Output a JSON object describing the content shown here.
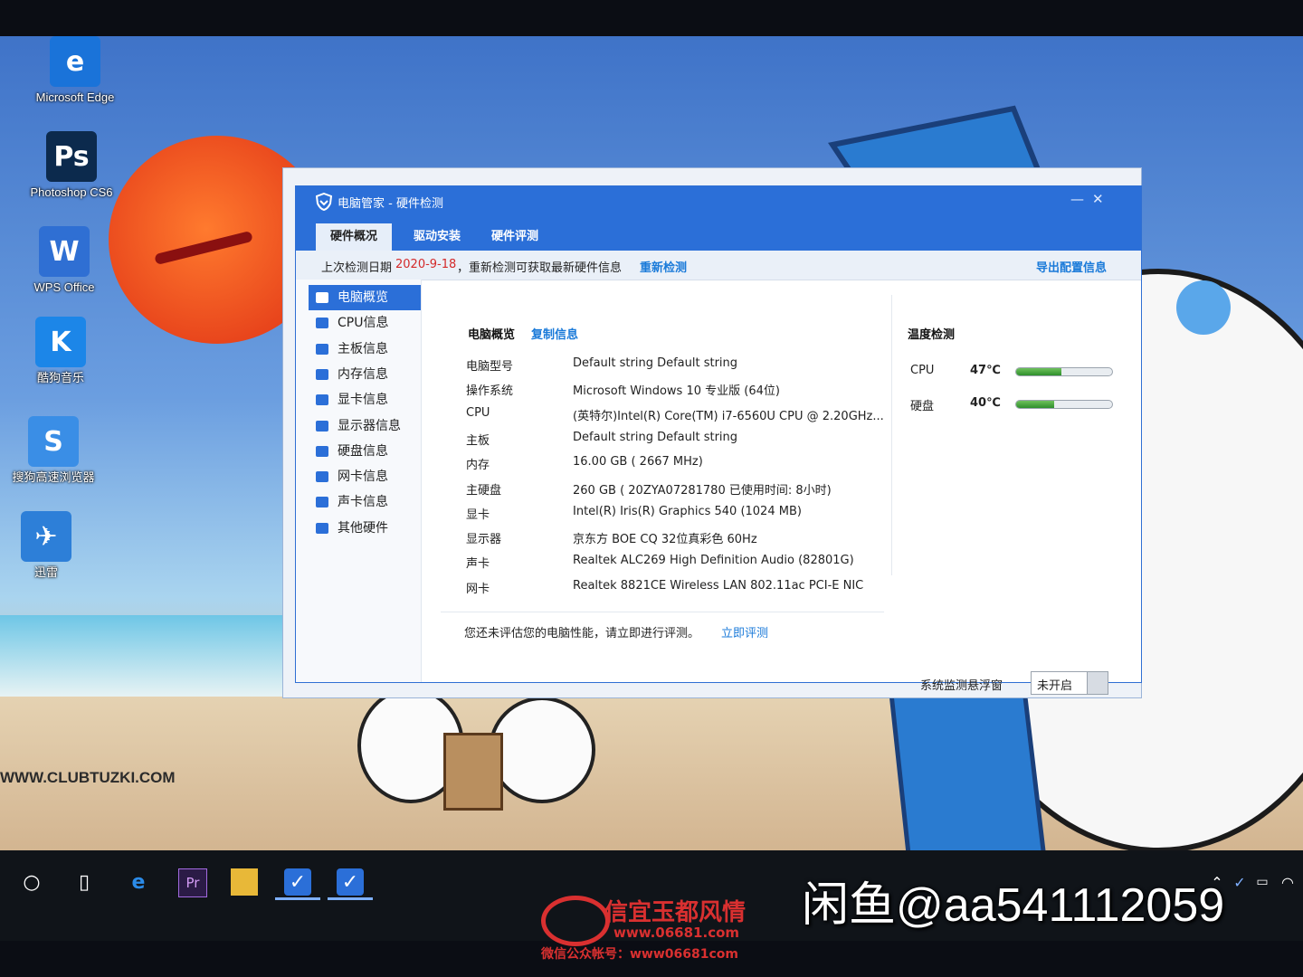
{
  "desktop": {
    "icons": [
      {
        "label": "Microsoft Edge",
        "glyph": "e",
        "icon": "edge-icon",
        "color": "#1a73d9"
      },
      {
        "label": "Photoshop CS6",
        "glyph": "Ps",
        "icon": "photoshop-icon",
        "color": "#0c2a4d"
      },
      {
        "label": "WPS Office",
        "glyph": "W",
        "icon": "wps-icon",
        "color": "#2f6fd3"
      },
      {
        "label": "酷狗音乐",
        "glyph": "K",
        "icon": "kugou-icon",
        "color": "#1c86e8"
      },
      {
        "label": "搜狗高速浏览器",
        "glyph": "S",
        "icon": "sogou-browser-icon",
        "color": "#3a8ee6"
      },
      {
        "label": "迅雷",
        "glyph": "✈",
        "icon": "xunlei-icon",
        "color": "#2d7fd8"
      }
    ],
    "wallpaper_site": "WWW.CLUBTUZKI.COM"
  },
  "window": {
    "title": "电脑管家 - 硬件检测",
    "tabs": [
      "硬件概况",
      "驱动安装",
      "硬件评测"
    ],
    "active_tab": "硬件概况",
    "info": {
      "prefix": "上次检测日期",
      "date": "2020-9-18",
      "suffix": "，重新检测可获取最新硬件信息",
      "redetect": "重新检测",
      "export": "导出配置信息"
    },
    "sidebar": [
      "电脑概览",
      "CPU信息",
      "主板信息",
      "内存信息",
      "显卡信息",
      "显示器信息",
      "硬盘信息",
      "网卡信息",
      "声卡信息",
      "其他硬件"
    ],
    "overview": {
      "title": "电脑概览",
      "copy": "复制信息",
      "rows": [
        {
          "k": "电脑型号",
          "v": "Default string Default string"
        },
        {
          "k": "操作系统",
          "v": "Microsoft Windows 10 专业版 (64位)"
        },
        {
          "k": "CPU",
          "v": "(英特尔)Intel(R) Core(TM) i7-6560U CPU @ 2.20GHz..."
        },
        {
          "k": "主板",
          "v": "Default string Default string"
        },
        {
          "k": "内存",
          "v": "16.00 GB (   2667 MHz)"
        },
        {
          "k": "主硬盘",
          "v": "260 GB (   20ZYA07281780 已使用时间: 8小时)"
        },
        {
          "k": "显卡",
          "v": "Intel(R) Iris(R) Graphics 540 (1024 MB)"
        },
        {
          "k": "显示器",
          "v": "京东方 BOE CQ 32位真彩色 60Hz"
        },
        {
          "k": "声卡",
          "v": "Realtek ALC269 High Definition Audio (82801G)"
        },
        {
          "k": "网卡",
          "v": "Realtek 8821CE Wireless LAN 802.11ac PCI-E NIC"
        }
      ]
    },
    "temperature": {
      "title": "温度检测",
      "items": [
        {
          "name": "CPU",
          "value": "47℃",
          "level": 0.47
        },
        {
          "name": "硬盘",
          "value": "40℃",
          "level": 0.4
        }
      ]
    },
    "eval_prompt": "您还未评估您的电脑性能，请立即进行评测。",
    "eval_link": "立即评测",
    "monitor_label": "系统监测悬浮窗",
    "monitor_state": "未开启"
  },
  "watermarks": {
    "xianyu": "闲鱼@aa541112059",
    "red_title": "信宜玉都风情",
    "red_url": "www.06681.com",
    "red_wechat": "微信公众帐号：www06681com"
  }
}
